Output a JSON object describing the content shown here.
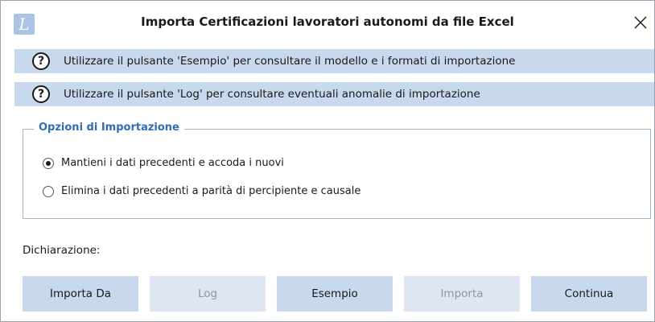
{
  "window": {
    "title": "Importa Certificazioni lavoratori autonomi da file Excel",
    "logo_letter": "L",
    "close_icon": "close-icon"
  },
  "info": [
    {
      "icon": "help-icon",
      "text": "Utilizzare il pulsante 'Esempio' per consultare il modello e i formati di importazione"
    },
    {
      "icon": "help-icon",
      "text": "Utilizzare il pulsante 'Log' per consultare eventuali anomalie di importazione"
    }
  ],
  "options": {
    "legend": "Opzioni di Importazione",
    "items": [
      {
        "label": "Mantieni i dati precedenti e accoda i nuovi",
        "selected": true
      },
      {
        "label": "Elimina i dati precedenti a parità di percipiente e causale",
        "selected": false
      }
    ]
  },
  "dichiarazione": {
    "label": "Dichiarazione:"
  },
  "buttons": {
    "importa_da": "Importa Da",
    "log": "Log",
    "esempio": "Esempio",
    "importa": "Importa",
    "continua": "Continua"
  },
  "colors": {
    "accent": "#2f6db5",
    "info_bg": "#c8d8ed",
    "button_bg": "#c8d8ed",
    "button_disabled_bg": "#dde6f2",
    "disabled_text": "#8e96a3"
  }
}
